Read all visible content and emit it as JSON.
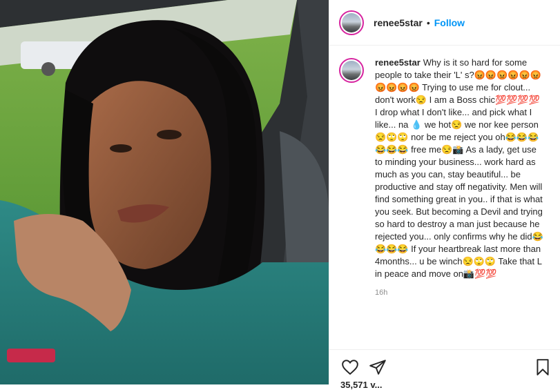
{
  "post": {
    "username": "renee5star",
    "dot": "•",
    "follow_label": "Follow",
    "caption_username": "renee5star",
    "caption_text": "Why is it so hard for some people to take their 'L' s?😡😡😡😡😡😡😡😡😡😡 Trying to use me for clout... don't work😒 I am a Boss chic💯💯💯💯 I drop what I don't like... and pick what I like... na 💧 we hot😒 we nor kee person 😒🙄🙄 nor be me reject you oh😂😂😂😂😂😂 free me😒📸 As a lady, get use to minding your business... work hard as much as you can, stay beautiful... be productive and stay off negativity. Men will find something great in you.. if that is what you seek. But becoming a Devil and trying so hard to destroy a man just because he rejected you... only confirms why he did😂😂😂😂 If your heartbreak last more than 4months... u be winch😒🙄🙄 Take that L in peace and move on📸💯💯",
    "timestamp": "16h",
    "likes_partial": "35,571 v..."
  },
  "icons": {
    "heart": "heart-icon",
    "share": "paper-plane-icon",
    "save": "bookmark-icon"
  },
  "colors": {
    "link": "#0095f6",
    "text": "#262626",
    "muted": "#8e8e8e",
    "story_ring": "#d6249f"
  }
}
